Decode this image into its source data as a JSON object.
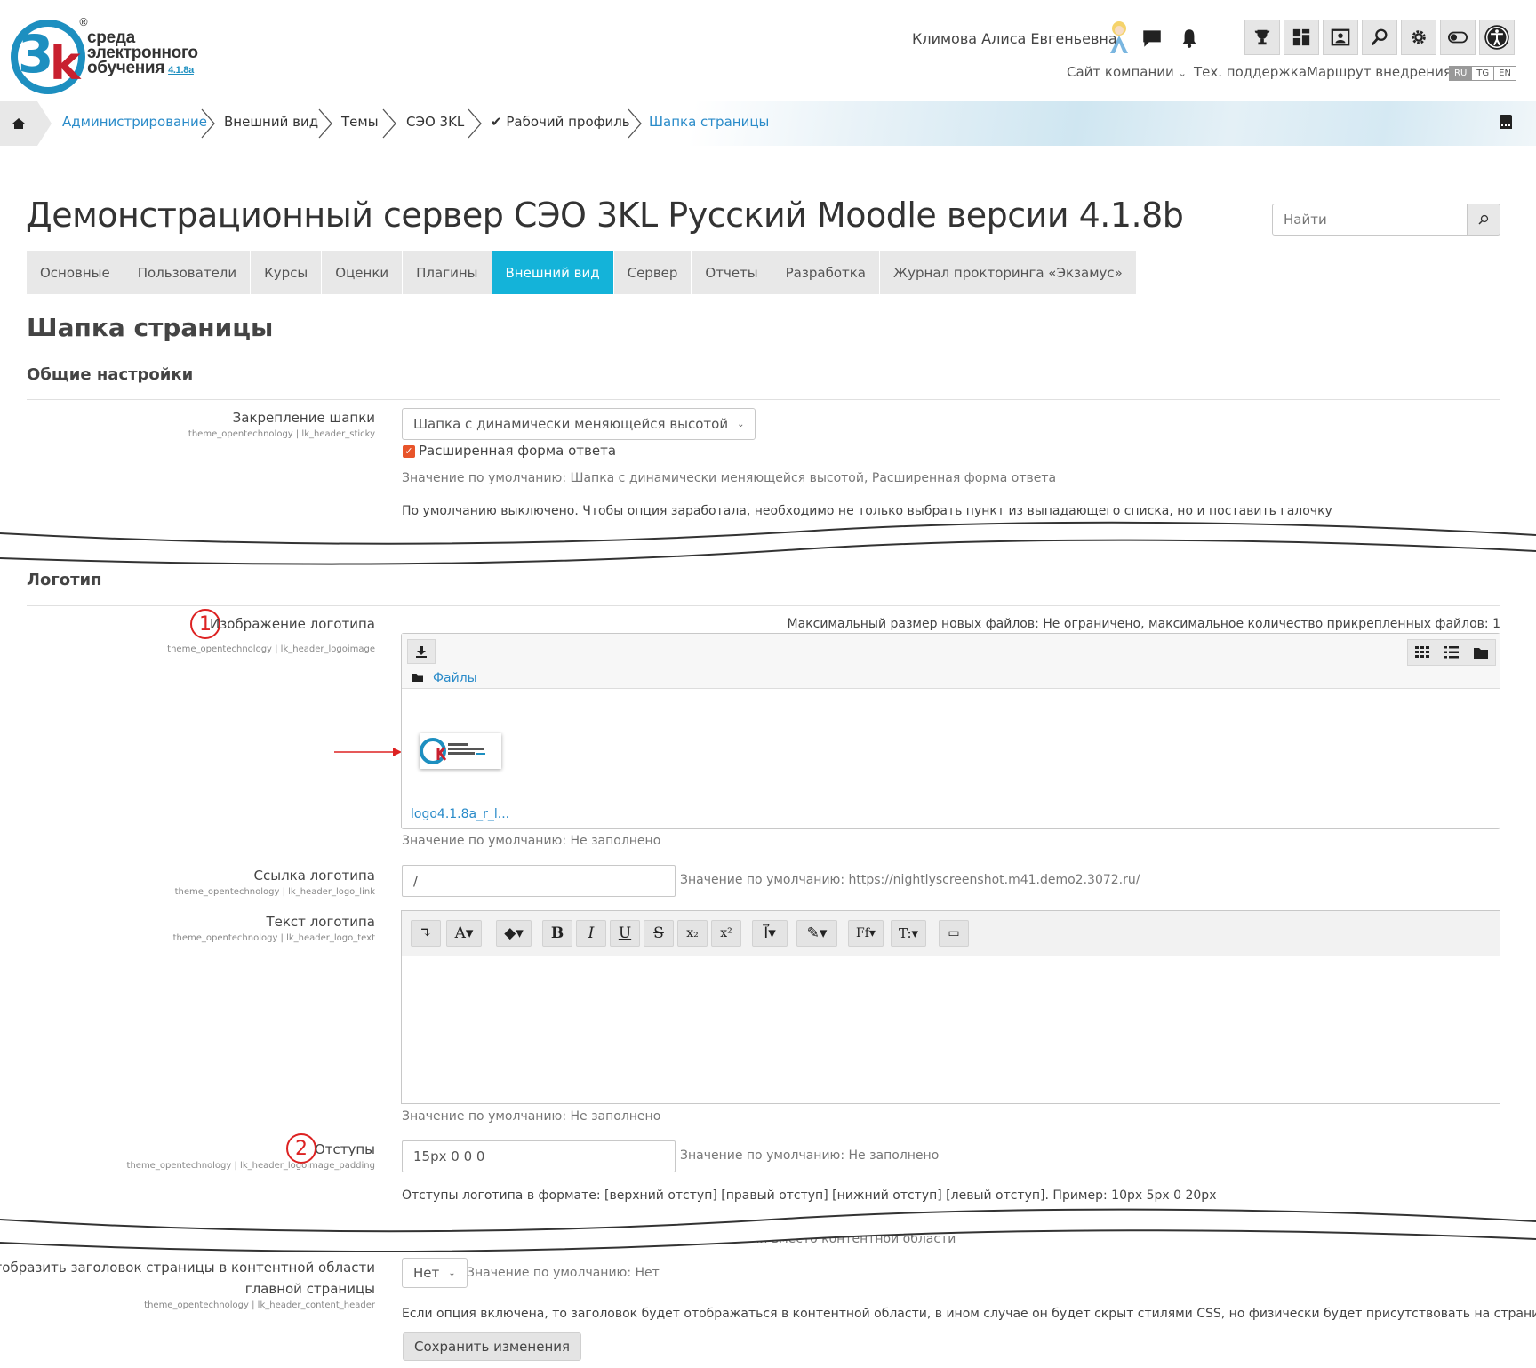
{
  "logo": {
    "line1": "среда",
    "line2": "электронного",
    "line3": "обучения",
    "version": "4.1.8a",
    "reg": "®",
    "letter3": "3",
    "letterk": "k"
  },
  "header": {
    "user_name": "Климова Алиса Евгеньевна",
    "links": [
      "Сайт компании",
      "Тех. поддержка",
      "Маршрут внедрения"
    ],
    "languages": [
      "RU",
      "TG",
      "EN"
    ],
    "active_language": "RU"
  },
  "breadcrumb": [
    "Администрирование",
    "Внешний вид",
    "Темы",
    "СЭО 3KL",
    "✔ Рабочий профиль",
    "Шапка страницы"
  ],
  "page_title": "Демонстрационный сервер СЭО 3KL Русский Moodle версии 4.1.8b",
  "search": {
    "placeholder": "Найти"
  },
  "tabs": [
    "Основные",
    "Пользователи",
    "Курсы",
    "Оценки",
    "Плагины",
    "Внешний вид",
    "Сервер",
    "Отчеты",
    "Разработка",
    "Журнал прокторинга «Экзамус»"
  ],
  "active_tab": "Внешний вид",
  "section_title": "Шапка страницы",
  "general": {
    "heading": "Общие настройки",
    "sticky_label": "Закрепление шапки",
    "sticky_key": "theme_opentechnology | lk_header_sticky",
    "sticky_value": "Шапка с динамически меняющейся высотой",
    "checkbox_label": "Расширенная форма ответа",
    "default": "Значение по умолчанию: Шапка с динамически меняющейся высотой, Расширенная форма ответа",
    "note": "По умолчанию выключено. Чтобы опция заработала, необходимо не только выбрать пункт из выпадающего списка, но и поставить галочку"
  },
  "logo_section": {
    "heading": "Логотип",
    "image_label": "Изображение логотипа",
    "image_key": "theme_opentechnology | lk_header_logoimage",
    "max_size": "Максимальный размер новых файлов: Не ограничено, максимальное количество прикрепленных файлов: 1",
    "files_path": "Файлы",
    "file_name": "logo4.1.8a_r_l...",
    "image_default": "Значение по умолчанию: Не заполнено",
    "link_label": "Ссылка логотипа",
    "link_key": "theme_opentechnology | lk_header_logo_link",
    "link_value": "/",
    "link_default": "Значение по умолчанию: https://nightlyscreenshot.m41.demo2.3072.ru/",
    "text_label": "Текст логотипа",
    "text_key": "theme_opentechnology | lk_header_logo_text",
    "text_default": "Значение по умолчанию: Не заполнено",
    "padding_label": "Отступы",
    "padding_key": "theme_opentechnology | lk_header_logoimage_padding",
    "padding_value": "15px 0 0 0",
    "padding_default": "Значение по умолчанию: Не заполнено",
    "padding_note": "Отступы логотипа в формате: [верхний отступ] [правый отступ] [нижний отступ] [левый отступ]. Пример: 10px 5px 0 20px"
  },
  "editor_buttons": [
    "↴",
    "A▾",
    "◆▾",
    "B",
    "I",
    "U",
    "S",
    "x₂",
    "x²",
    "I⃗▾",
    "✎▾",
    "Ff▾",
    "T:▾",
    "▭"
  ],
  "annotations": {
    "one": "1",
    "two": "2"
  },
  "content_header": {
    "partial": "в док панели вместо контентной области",
    "label_line1": "Отобразить заголовок страницы в контентной области",
    "label_line2": "главной страницы",
    "key": "theme_opentechnology | lk_header_content_header",
    "value": "Нет",
    "default": "Значение по умолчанию: Нет",
    "note": "Если опция включена, то заголовок будет отображаться в контентной области, в ином случае он будет скрыт стилями CSS, но физически будет присутствовать на странице."
  },
  "save_label": "Сохранить изменения",
  "colors": {
    "accent": "#14b3d9",
    "link": "#2a8bc9",
    "checkbox": "#e8542a",
    "annotation": "#dd2222"
  }
}
